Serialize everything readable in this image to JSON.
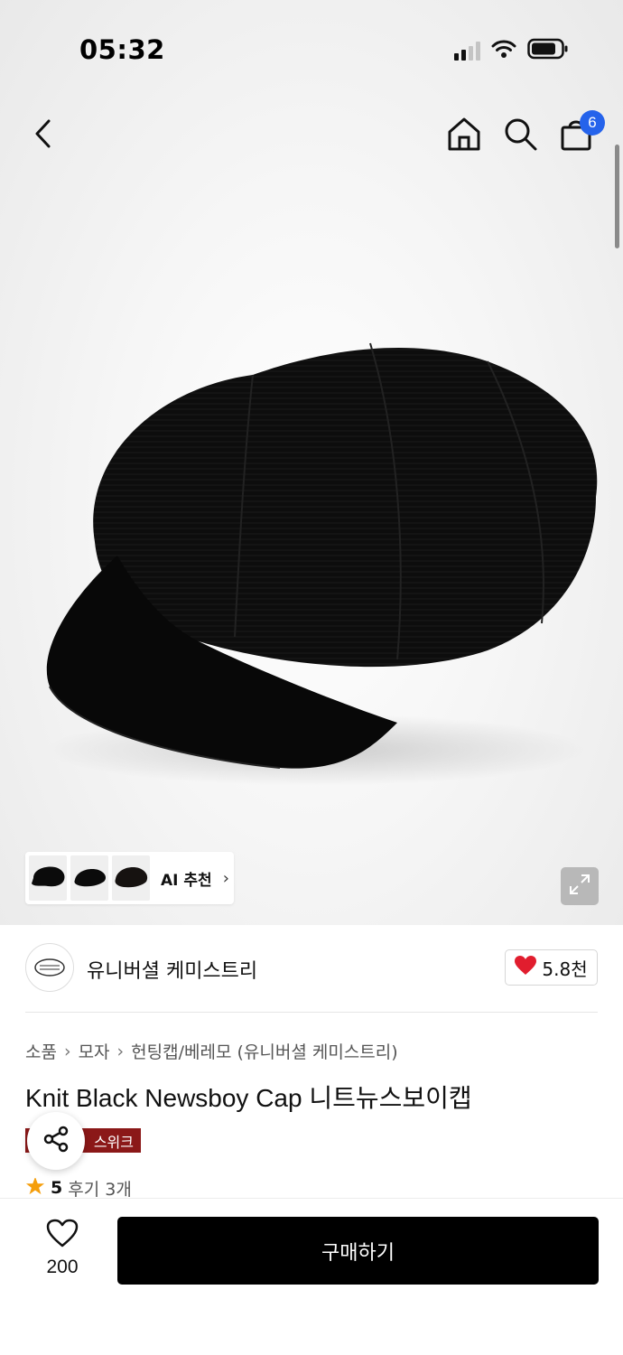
{
  "status_bar": {
    "time": "05:32"
  },
  "header": {
    "cart_count": "6"
  },
  "ai_recommend": {
    "label": "AI 추천",
    "chevron": "›"
  },
  "brand": {
    "name": "유니버셜 케미스트리",
    "likes": "5.8천"
  },
  "breadcrumb": {
    "items": [
      "소품",
      "모자",
      "헌팅캡/베레모 (유니버셜 케미스트리)"
    ],
    "separator": "›"
  },
  "product": {
    "title": "Knit Black Newsboy Cap 니트뉴스보이캡",
    "tag": "스위크",
    "rating": "5",
    "reviews": "후기 3개"
  },
  "bottom_bar": {
    "wish_count": "200",
    "buy_label": "구매하기"
  },
  "icons": {
    "back": "chevron-left-icon",
    "home": "home-icon",
    "search": "search-icon",
    "cart": "shopping-bag-icon",
    "expand": "expand-icon",
    "share": "share-icon",
    "heart": "heart-icon",
    "star": "star-icon"
  },
  "colors": {
    "accent_badge": "#2563eb",
    "heart": "#e11d2e",
    "tag": "#8b1818",
    "star": "#f59e0b",
    "buy_button": "#000000"
  }
}
